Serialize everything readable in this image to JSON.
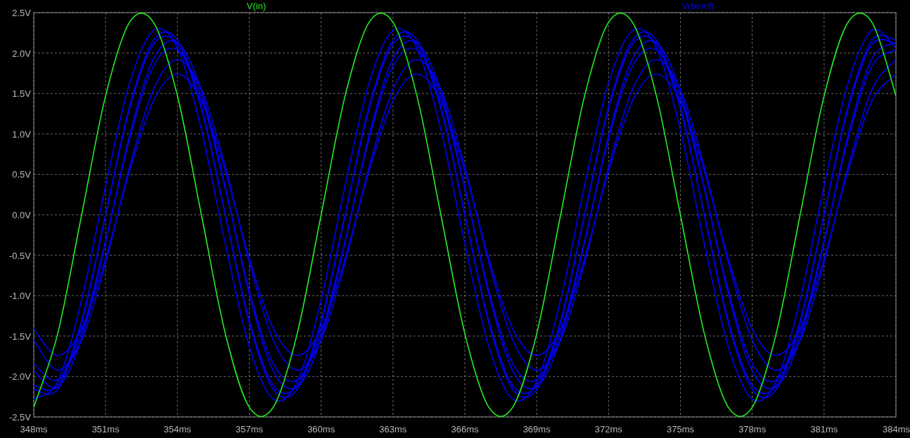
{
  "plot": {
    "chart_data": {
      "type": "line",
      "grid": true,
      "xlim": [
        348,
        384
      ],
      "ylim": [
        -2.5,
        2.5
      ],
      "x": [
        348,
        349,
        350,
        351,
        352,
        353,
        354,
        355,
        356,
        357,
        358,
        359,
        360,
        361,
        362,
        363,
        364,
        365,
        366,
        367,
        368,
        369,
        370,
        371,
        372,
        373,
        374,
        375,
        376,
        377,
        378,
        379,
        380,
        381,
        382,
        383,
        384
      ],
      "xticks": [
        {
          "value": 348,
          "label": "348ms"
        },
        {
          "value": 351,
          "label": "351ms"
        },
        {
          "value": 354,
          "label": "354ms"
        },
        {
          "value": 357,
          "label": "357ms"
        },
        {
          "value": 360,
          "label": "360ms"
        },
        {
          "value": 363,
          "label": "363ms"
        },
        {
          "value": 366,
          "label": "366ms"
        },
        {
          "value": 369,
          "label": "369ms"
        },
        {
          "value": 372,
          "label": "372ms"
        },
        {
          "value": 375,
          "label": "375ms"
        },
        {
          "value": 378,
          "label": "378ms"
        },
        {
          "value": 381,
          "label": "381ms"
        },
        {
          "value": 384,
          "label": "384ms"
        }
      ],
      "yticks": [
        {
          "value": 2.5,
          "label": "2.5V"
        },
        {
          "value": 2.0,
          "label": "2.0V"
        },
        {
          "value": 1.5,
          "label": "1.5V"
        },
        {
          "value": 1.0,
          "label": "1.0V"
        },
        {
          "value": 0.5,
          "label": "0.5V"
        },
        {
          "value": 0.0,
          "label": "0.0V"
        },
        {
          "value": -0.5,
          "label": "-0.5V"
        },
        {
          "value": -1.0,
          "label": "-1.0V"
        },
        {
          "value": -1.5,
          "label": "-1.5V"
        },
        {
          "value": -2.0,
          "label": "-2.0V"
        },
        {
          "value": -2.5,
          "label": "-2.5V"
        }
      ],
      "series": [
        {
          "name": "V(in)",
          "color": "#22ee22",
          "values": [
            -2.38,
            -1.47,
            0,
            1.47,
            2.38,
            2.38,
            1.47,
            0,
            -1.47,
            -2.38,
            -2.38,
            -1.47,
            0,
            1.47,
            2.38,
            2.38,
            1.47,
            0,
            -1.47,
            -2.38,
            -2.38,
            -1.47,
            0,
            1.47,
            2.38,
            2.38,
            1.47,
            0,
            -1.47,
            -2.38,
            -2.38,
            -1.47,
            0,
            1.47,
            2.38,
            2.38,
            1.47
          ]
        },
        {
          "name": "V(bemf)",
          "color": "#0000ee",
          "values": [
            -2.28,
            -2.06,
            -1.05,
            0.36,
            1.63,
            2.28,
            2.06,
            1.05,
            -0.36,
            -1.63,
            -2.28,
            -2.06,
            -1.05,
            0.36,
            1.63,
            2.28,
            2.06,
            1.05,
            -0.36,
            -1.63,
            -2.28,
            -2.06,
            -1.05,
            0.36,
            1.63,
            2.28,
            2.06,
            1.05,
            -0.36,
            -1.63,
            -2.28,
            -2.06,
            -1.05,
            0.36,
            1.63,
            2.28,
            2.06
          ]
        },
        {
          "color": "#0000ee",
          "values": [
            -2.16,
            -2.16,
            -1.34,
            0,
            1.34,
            2.16,
            2.16,
            1.34,
            0,
            -1.34,
            -2.16,
            -2.16,
            -1.34,
            0,
            1.34,
            2.16,
            2.16,
            1.34,
            0,
            -1.34,
            -2.16,
            -2.16,
            -1.34,
            0,
            1.34,
            2.16,
            2.16,
            1.34,
            0,
            -1.34,
            -2.16,
            -2.16,
            -1.34,
            0,
            1.34,
            2.16,
            2.16
          ]
        },
        {
          "color": "#0000ee",
          "values": [
            -2.11,
            -2.11,
            -1.31,
            0,
            1.31,
            2.11,
            2.11,
            1.31,
            0,
            -1.31,
            -2.11,
            -2.11,
            -1.31,
            0,
            1.31,
            2.11,
            2.11,
            1.31,
            0,
            -1.31,
            -2.11,
            -2.11,
            -1.31,
            0,
            1.31,
            2.11,
            2.11,
            1.31,
            0,
            -1.31,
            -2.11,
            -2.11,
            -1.31,
            0,
            1.31,
            2.11,
            2.11
          ]
        },
        {
          "color": "#0000ee",
          "values": [
            -1.93,
            -2.13,
            -1.53,
            -0.34,
            0.98,
            1.93,
            2.13,
            1.53,
            0.34,
            -0.98,
            -1.93,
            -2.13,
            -1.53,
            -0.34,
            0.98,
            1.93,
            2.13,
            1.53,
            0.34,
            -0.98,
            -1.93,
            -2.13,
            -1.53,
            -0.34,
            0.98,
            1.93,
            2.13,
            1.53,
            0.34,
            -0.98,
            -1.93,
            -2.13,
            -1.53,
            -0.34,
            0.98,
            1.93,
            2.13
          ]
        },
        {
          "color": "#0000ee",
          "values": [
            -1.84,
            -2.04,
            -1.46,
            -0.32,
            0.94,
            1.84,
            2.04,
            1.46,
            0.32,
            -0.94,
            -1.84,
            -2.04,
            -1.46,
            -0.32,
            0.94,
            1.84,
            2.04,
            1.46,
            0.32,
            -0.94,
            -1.84,
            -2.04,
            -1.46,
            -0.32,
            0.94,
            1.84,
            2.04,
            1.46,
            0.32,
            -0.94,
            -1.84,
            -2.04,
            -1.46,
            -0.32,
            0.94,
            1.84,
            2.04
          ]
        },
        {
          "color": "#0000ee",
          "values": [
            -1.55,
            -1.92,
            -1.55,
            -0.59,
            0.59,
            1.55,
            1.92,
            1.55,
            0.59,
            -0.59,
            -1.55,
            -1.92,
            -1.55,
            -0.59,
            0.59,
            1.55,
            1.92,
            1.55,
            0.59,
            -0.59,
            -1.55,
            -1.92,
            -1.55,
            -0.59,
            0.59,
            1.55,
            1.92,
            1.55,
            0.59,
            -0.59,
            -1.55,
            -1.92,
            -1.55,
            -0.59,
            0.59,
            1.55,
            1.92
          ]
        },
        {
          "color": "#0000ee",
          "values": [
            -1.41,
            -1.74,
            -1.41,
            -0.54,
            0.54,
            1.41,
            1.74,
            1.41,
            0.54,
            -0.54,
            -1.41,
            -1.74,
            -1.41,
            -0.54,
            0.54,
            1.41,
            1.74,
            1.41,
            0.54,
            -0.54,
            -1.41,
            -1.74,
            -1.41,
            -0.54,
            0.54,
            1.41,
            1.74,
            1.41,
            0.54,
            -0.54,
            -1.41,
            -1.74,
            -1.41,
            -0.54,
            0.54,
            1.41,
            1.74
          ]
        }
      ]
    }
  }
}
